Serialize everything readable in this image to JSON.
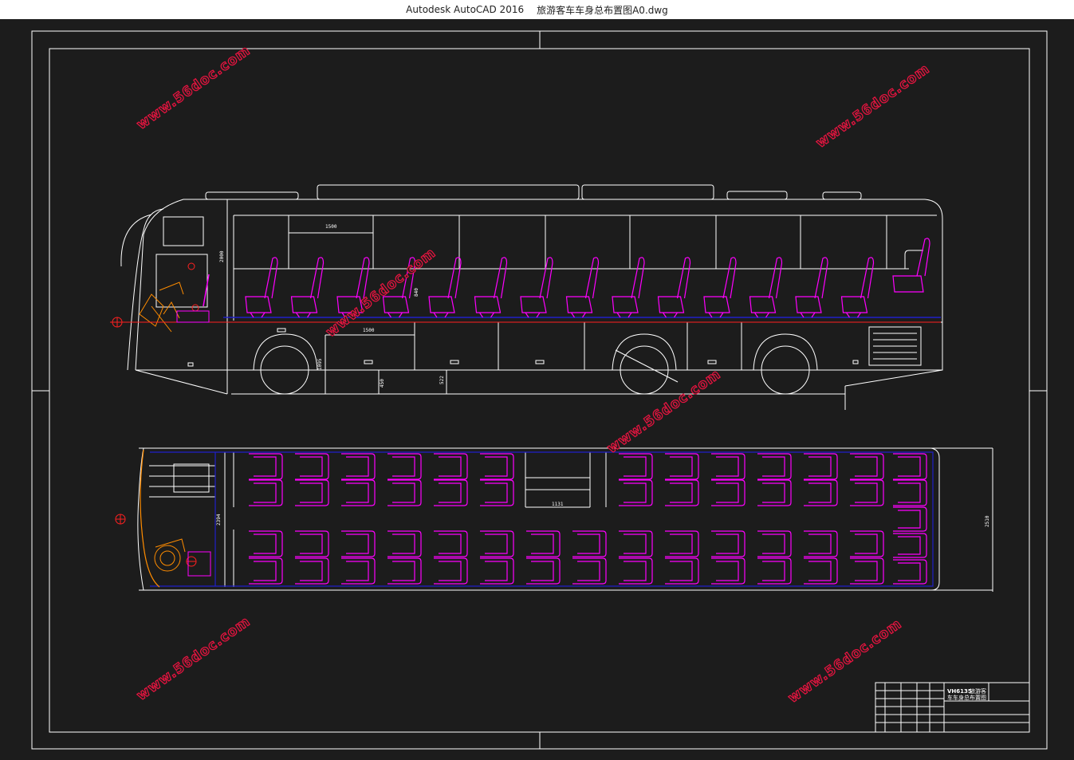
{
  "window": {
    "app_name": "Autodesk AutoCAD 2016",
    "file_name": "旅游客车车身总布置图A0.dwg"
  },
  "watermark": {
    "text": "www.56doc.com",
    "color": "#e81440"
  },
  "dimensions": {
    "d1500_top": "1500",
    "d2000": "2000",
    "d840": "840",
    "d1500_mid": "1500",
    "d1095": "1095",
    "d450": "450",
    "d522": "522",
    "d1131": "1131",
    "d2394": "2394",
    "d2510": "2510"
  },
  "title_block": {
    "model": "VH6135",
    "name_line1": "旅游客",
    "name_line2": "车车身总布置图"
  },
  "colors": {
    "background": "#1c1c1c",
    "lines": "#ffffff",
    "seats": "#ff00ff",
    "floor": "#2020c8",
    "driver": "#ff8c00",
    "centerline": "#ff2020"
  }
}
